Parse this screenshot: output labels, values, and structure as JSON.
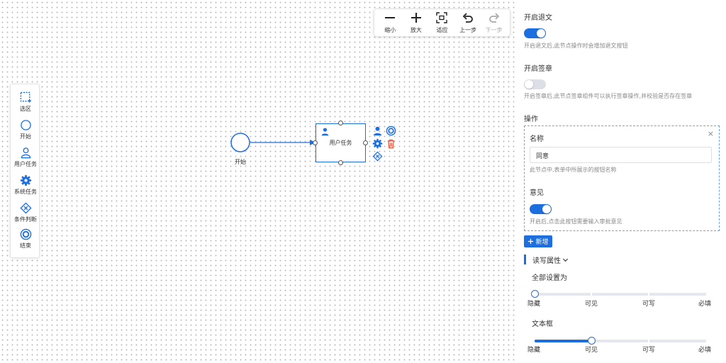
{
  "toolbar": {
    "zoom_out": "缩小",
    "zoom_in": "放大",
    "fit": "适应",
    "undo": "上一步",
    "redo": "下一步"
  },
  "palette": {
    "select": "选区",
    "start": "开始",
    "user_task": "用户任务",
    "system_task": "系统任务",
    "condition": "条件判断",
    "end": "结束"
  },
  "diagram": {
    "start_label": "开始",
    "task_label": "用户任务"
  },
  "panel": {
    "return": {
      "title": "开启退文",
      "enabled": true,
      "hint": "开启退文后,此节点操作时会增加退文按钮"
    },
    "seal": {
      "title": "开启签章",
      "enabled": false,
      "hint": "开启签章后,此节点签章组件可以执行签章操作,并校验是否存在签章"
    },
    "operations": {
      "title": "操作",
      "close": "×",
      "name_label": "名称",
      "name_value": "同意",
      "name_hint": "此节点中,表单中所展示的按钮名称",
      "opinion_label": "意见",
      "opinion_enabled": true,
      "opinion_hint": "开启后,点击此按钮需要输入审批意见",
      "add_label": "新增"
    },
    "rw": {
      "title": "读写属性",
      "set_all_label": "全部设置为",
      "set_all_value": "隐藏",
      "textbox_label": "文本框",
      "textbox_value": "可见",
      "levels": [
        "隐藏",
        "可见",
        "可写",
        "必填"
      ]
    }
  },
  "colors": {
    "primary": "#1d6fe0",
    "danger": "#e0533c"
  }
}
